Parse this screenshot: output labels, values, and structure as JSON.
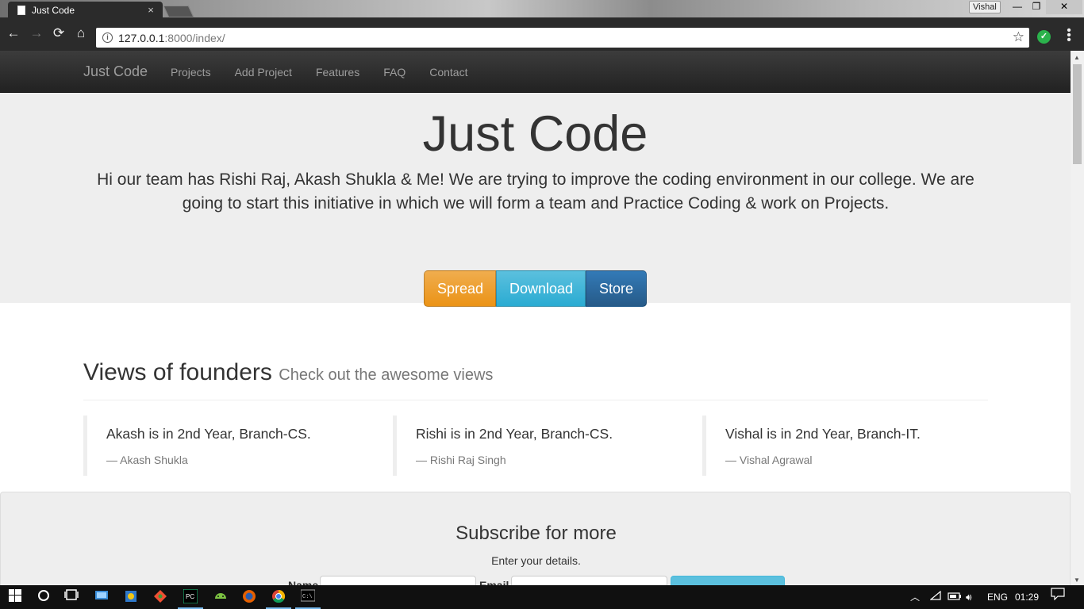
{
  "browser": {
    "tab_title": "Just Code",
    "tab_close": "×",
    "profile_name": "Vishal",
    "window_min": "—",
    "window_max": "❐",
    "window_close": "✕",
    "back": "←",
    "forward": "→",
    "reload": "⟳",
    "home": "⌂",
    "url_host": "127.0.0.1",
    "url_path": ":8000/index/",
    "info_icon": "i",
    "star_icon": "☆",
    "extension_icon": "✓",
    "menu_icon": "⋮"
  },
  "site": {
    "brand": "Just Code",
    "nav": [
      "Projects",
      "Add Project",
      "Features",
      "FAQ",
      "Contact"
    ],
    "jumbotron": {
      "title": "Just Code",
      "text": "Hi our team has Rishi Raj, Akash Shukla & Me! We are trying to improve the coding environment in our college. We are going to start this initiative in which we will form a team and Practice Coding & work on Projects.",
      "buttons": [
        "Spread",
        "Download",
        "Store"
      ]
    },
    "founders": {
      "heading": "Views of founders",
      "subheading": "Check out the awesome views",
      "quotes": [
        {
          "text": "Akash is in 2nd Year, Branch-CS.",
          "author": "—  Akash Shukla"
        },
        {
          "text": "Rishi is in 2nd Year, Branch-CS.",
          "author": "—  Rishi Raj Singh"
        },
        {
          "text": "Vishal is in 2nd Year, Branch-IT.",
          "author": "—  Vishal Agrawal"
        }
      ]
    },
    "subscribe": {
      "title": "Subscribe for more",
      "text": "Enter your details.",
      "name_label": "Name",
      "email_label": "Email"
    }
  },
  "taskbar": {
    "language": "ENG",
    "time": "01:29",
    "icons": [
      "windows-start-icon",
      "cortana-icon",
      "task-view-icon",
      "control-panel-icon",
      "paint-icon",
      "git-icon",
      "pycharm-icon",
      "android-studio-icon",
      "firefox-icon",
      "chrome-icon",
      "cmd-icon"
    ]
  }
}
